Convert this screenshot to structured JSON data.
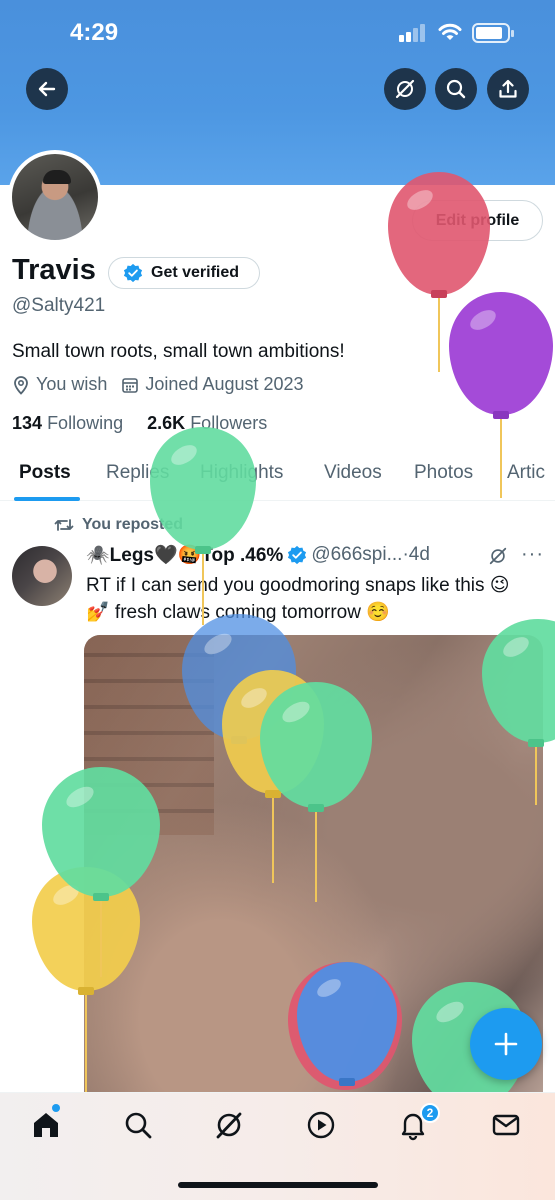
{
  "status_bar": {
    "time": "4:29"
  },
  "header": {
    "back_icon": "arrow-left-icon",
    "actions": [
      "grok-icon",
      "search-icon",
      "share-icon"
    ],
    "banner_color": "#4a90dc"
  },
  "profile": {
    "name": "Travis",
    "get_verified_label": "Get verified",
    "handle": "@Salty421",
    "edit_profile_label": "Edit profile",
    "bio": "Small town roots, small town ambitions!",
    "location": "You wish",
    "joined": "Joined August 2023",
    "following_count": "134",
    "following_label": "Following",
    "followers_count": "2.6K",
    "followers_label": "Followers"
  },
  "tabs": [
    "Posts",
    "Replies",
    "Highlights",
    "Videos",
    "Photos",
    "Artic"
  ],
  "active_tab": "Posts",
  "post": {
    "repost_label": "You reposted",
    "author": "🕷️Legs🖤🤬Top .46%",
    "handle": "@666spi...",
    "time": "·4d",
    "more": "···",
    "text": "RT if I can send you goodmoring snaps like this 😉 💅 fresh claws coming tomorrow ☺️"
  },
  "fab_label": "+",
  "bottom_nav": {
    "items": [
      "home-icon",
      "search-icon",
      "grok-icon",
      "video-icon",
      "notifications-icon",
      "messages-icon"
    ],
    "notification_count": "2"
  },
  "colors": {
    "accent": "#1d9bf0",
    "balloon_red": "#e0566f",
    "balloon_purple": "#a44bd8",
    "balloon_green": "#62dca0",
    "balloon_blue": "#4f8fe3",
    "balloon_yellow": "#f2cd4c"
  }
}
